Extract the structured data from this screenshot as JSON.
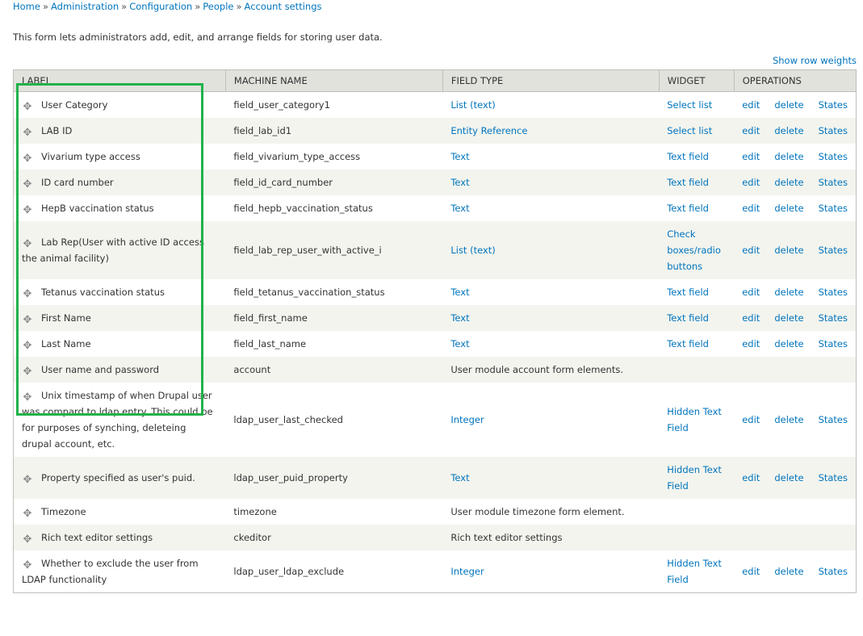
{
  "breadcrumb": [
    "Home",
    "Administration",
    "Configuration",
    "People",
    "Account settings"
  ],
  "breadcrumb_separator": "»",
  "description": "This form lets administrators add, edit, and arrange fields for storing user data.",
  "show_row_weights": "Show row weights",
  "columns": [
    "LABEL",
    "MACHINE NAME",
    "FIELD TYPE",
    "WIDGET",
    "OPERATIONS"
  ],
  "highlight_color": "#21b24a",
  "link_color": "#0074bd",
  "operations": {
    "edit": "edit",
    "delete": "delete",
    "states": "States"
  },
  "rows": [
    {
      "label": "User Category",
      "machine": "field_user_category1",
      "type": "List (text)",
      "widget": "Select list",
      "ops": true
    },
    {
      "label": "LAB ID",
      "machine": "field_lab_id1",
      "type": "Entity Reference",
      "widget": "Select list",
      "ops": true
    },
    {
      "label": "Vivarium type access",
      "machine": "field_vivarium_type_access",
      "type": "Text",
      "widget": "Text field",
      "ops": true
    },
    {
      "label": "ID card number",
      "machine": "field_id_card_number",
      "type": "Text",
      "widget": "Text field",
      "ops": true
    },
    {
      "label": "HepB vaccination status",
      "machine": "field_hepb_vaccination_status",
      "type": "Text",
      "widget": "Text field",
      "ops": true
    },
    {
      "label": "Lab Rep(User with active ID access the animal facility)",
      "machine": "field_lab_rep_user_with_active_i",
      "type": "List (text)",
      "widget": "Check boxes/radio buttons",
      "ops": true
    },
    {
      "label": "Tetanus vaccination status",
      "machine": "field_tetanus_vaccination_status",
      "type": "Text",
      "widget": "Text field",
      "ops": true
    },
    {
      "label": "First Name",
      "machine": "field_first_name",
      "type": "Text",
      "widget": "Text field",
      "ops": true
    },
    {
      "label": "Last Name",
      "machine": "field_last_name",
      "type": "Text",
      "widget": "Text field",
      "ops": true
    },
    {
      "label": "User name and password",
      "machine": "account",
      "plain": "User module account form elements.",
      "ops": false
    },
    {
      "label": "Unix timestamp of when Drupal user was compard to ldap entry. This could be for purposes of synching, deleteing drupal account, etc.",
      "machine": "ldap_user_last_checked",
      "type": "Integer",
      "widget": "Hidden Text Field",
      "ops": true
    },
    {
      "label": "Property specified as user's puid.",
      "machine": "ldap_user_puid_property",
      "type": "Text",
      "widget": "Hidden Text Field",
      "ops": true
    },
    {
      "label": "Timezone",
      "machine": "timezone",
      "plain": "User module timezone form element.",
      "ops": false
    },
    {
      "label": "Rich text editor settings",
      "machine": "ckeditor",
      "plain": "Rich text editor settings",
      "ops": false
    },
    {
      "label": "Whether to exclude the user from LDAP functionality",
      "machine": "ldap_user_ldap_exclude",
      "type": "Integer",
      "widget": "Hidden Text Field",
      "ops": true
    }
  ]
}
